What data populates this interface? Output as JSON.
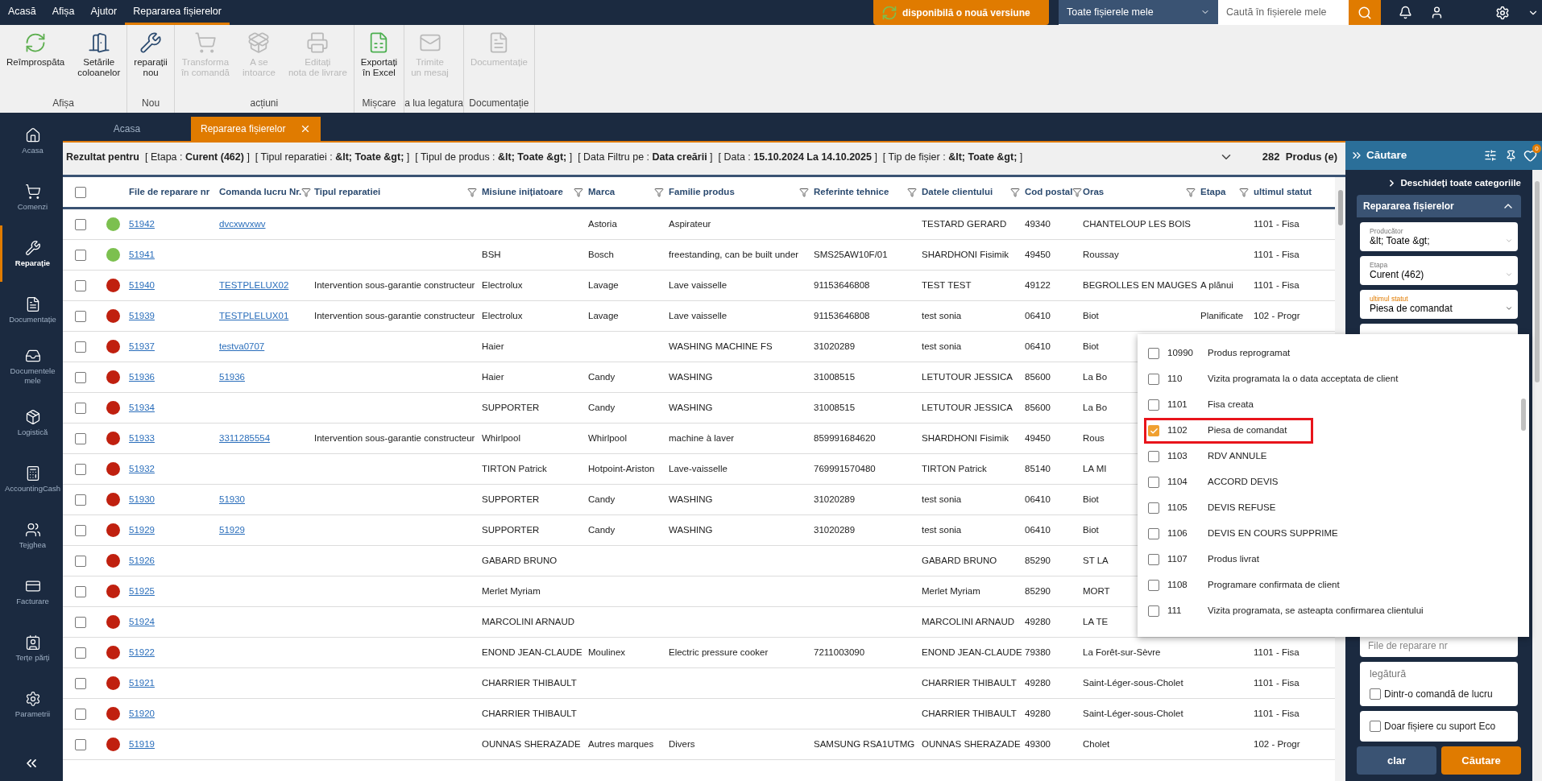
{
  "menu": [
    {
      "label": "Acasă",
      "selected": false
    },
    {
      "label": "Afișa",
      "selected": false
    },
    {
      "label": "Ajutor",
      "selected": false
    },
    {
      "label": "Repararea fișierelor",
      "selected": true
    }
  ],
  "update_button": "disponibilă o nouă versiune",
  "scope_select": "Toate fișierele mele",
  "search": {
    "placeholder": "Caută în fișierele mele"
  },
  "ribbon": [
    {
      "group": "Afișa",
      "buttons": [
        {
          "label": "Reîmprospăta",
          "disabled": false
        },
        {
          "label": "Setările\ncoloanelor",
          "disabled": false
        }
      ]
    },
    {
      "group": "Nou",
      "buttons": [
        {
          "label": "reparații\nnou",
          "disabled": false
        }
      ]
    },
    {
      "group": "acțiuni",
      "buttons": [
        {
          "label": "Transforma\nîn comandă",
          "disabled": true
        },
        {
          "label": "A se\nintoarce",
          "disabled": true
        },
        {
          "label": "Editați\nnota de livrare",
          "disabled": true
        }
      ]
    },
    {
      "group": "Mișcare",
      "buttons": [
        {
          "label": "Exportați\nîn Excel",
          "disabled": false
        }
      ]
    },
    {
      "group": "a lua legatura",
      "buttons": [
        {
          "label": "Trimite\nun mesaj",
          "disabled": true
        }
      ]
    },
    {
      "group": "Documentație",
      "buttons": [
        {
          "label": "Documentație",
          "disabled": true
        }
      ]
    }
  ],
  "sidebar": [
    {
      "label": "Acasa",
      "selected": false
    },
    {
      "label": "Comenzi",
      "selected": false
    },
    {
      "label": "Reparație",
      "selected": true
    },
    {
      "label": "Documentație",
      "selected": false
    },
    {
      "label": "Documentele mele",
      "selected": false
    },
    {
      "label": "Logistică",
      "selected": false
    },
    {
      "label": "AccountingCash",
      "selected": false
    },
    {
      "label": "Tejghea",
      "selected": false
    },
    {
      "label": "Facturare",
      "selected": false
    },
    {
      "label": "Terțe părți",
      "selected": false
    },
    {
      "label": "Parametrii",
      "selected": false
    }
  ],
  "tabs": [
    {
      "label": "Acasa",
      "selected": false
    },
    {
      "label": "Repararea fișierelor",
      "selected": true
    }
  ],
  "result_summary": "**Rezultat pentru**  [ Etapa : **Curent (462)** ]  [ Tipul reparatiei : **&lt; Toate &gt;** ]  [ Tipul de produs : **&lt; Toate &gt;** ]  [ Data Filtru pe : **Data creării** ]  [ Data : **15.10.2024 La 14.10.2025** ]  [ Tip de fișier : **&lt; Toate &gt;** ]",
  "result_count": "282  Produs (e)",
  "table": {
    "select_all_checked": false,
    "columns": [
      {
        "label": "File de reparare nr",
        "filter": false
      },
      {
        "label": "Comanda lucru Nr.",
        "filter": true
      },
      {
        "label": "Tipul reparatiei",
        "filter": true
      },
      {
        "label": "Misiune inițiatoare",
        "filter": true
      },
      {
        "label": "Marca",
        "filter": true
      },
      {
        "label": "Familie produs",
        "filter": true
      },
      {
        "label": "Referinte tehnice",
        "filter": true
      },
      {
        "label": "Datele clientului",
        "filter": true
      },
      {
        "label": "Cod postal",
        "filter": true
      },
      {
        "label": "Oras",
        "filter": true
      },
      {
        "label": "Etapa",
        "filter": true
      },
      {
        "label": "ultimul statut",
        "filter": false
      }
    ],
    "rows": [
      {
        "checked": false,
        "color": "#7cc04f",
        "file": "51942",
        "order": "dvcxwvxwv",
        "brand": "Astoria",
        "family": "Aspirateur",
        "client": "TESTARD GERARD",
        "postcode": "49340",
        "city": "CHANTELOUP LES BOIS",
        "last_status": "1101 - Fisa"
      },
      {
        "checked": false,
        "color": "#7cc04f",
        "file": "51941",
        "mission": "BSH",
        "brand": "Bosch",
        "family": "freestanding, can be built under",
        "tech_ref": "SMS25AW10F/01",
        "client": "SHARDHONI Fisimik",
        "postcode": "49450",
        "city": "Roussay",
        "last_status": "1101 - Fisa"
      },
      {
        "checked": false,
        "color": "#c0200f",
        "file": "51940",
        "order": "TESTPLELUX02",
        "repair_type": "Intervention sous-garantie constructeur",
        "mission": "Electrolux",
        "brand": "Lavage",
        "family": "Lave vaisselle",
        "tech_ref": "91153646808",
        "client": "TEST TEST",
        "postcode": "49122",
        "city": "BEGROLLES EN MAUGES",
        "stage": "A plănui",
        "last_status": "1101 - Fisa"
      },
      {
        "checked": false,
        "color": "#c0200f",
        "file": "51939",
        "order": "TESTPLELUX01",
        "repair_type": "Intervention sous-garantie constructeur",
        "mission": "Electrolux",
        "brand": "Lavage",
        "family": "Lave vaisselle",
        "tech_ref": "91153646808",
        "client": "test  sonia",
        "postcode": "06410",
        "city": "Biot",
        "stage": "Planificate",
        "last_status": "102 - Progr"
      },
      {
        "checked": false,
        "color": "#c0200f",
        "file": "51937",
        "order": "testva0707",
        "mission": "Haier",
        "family": "WASHING MACHINE FS",
        "tech_ref": "31020289",
        "client": "test  sonia",
        "postcode": "06410",
        "city": "Biot"
      },
      {
        "checked": false,
        "color": "#c0200f",
        "file": "51936",
        "order": "51936",
        "mission": "Haier",
        "brand": "Candy",
        "family": "WASHING",
        "tech_ref": "31008515",
        "client": "LETUTOUR JESSICA",
        "postcode": "85600",
        "city": "La Bo"
      },
      {
        "checked": false,
        "color": "#c0200f",
        "file": "51934",
        "mission": "SUPPORTER",
        "brand": "Candy",
        "family": "WASHING",
        "tech_ref": "31008515",
        "client": "LETUTOUR JESSICA",
        "postcode": "85600",
        "city": "La Bo"
      },
      {
        "checked": false,
        "color": "#c0200f",
        "file": "51933",
        "order": "3311285554",
        "repair_type": "Intervention sous-garantie constructeur",
        "mission": "Whirlpool",
        "brand": "Whirlpool",
        "family": "machine à laver",
        "tech_ref": "859991684620",
        "client": "SHARDHONI Fisimik",
        "postcode": "49450",
        "city": "Rous"
      },
      {
        "checked": false,
        "color": "#c0200f",
        "file": "51932",
        "mission": "TIRTON Patrick",
        "brand": "Hotpoint-Ariston",
        "family": "Lave-vaisselle",
        "tech_ref": "769991570480",
        "client": "TIRTON Patrick",
        "postcode": "85140",
        "city": "LA MI"
      },
      {
        "checked": false,
        "color": "#c0200f",
        "file": "51930",
        "order": "51930",
        "mission": "SUPPORTER",
        "brand": "Candy",
        "family": "WASHING",
        "tech_ref": "31020289",
        "client": "test  sonia",
        "postcode": "06410",
        "city": "Biot"
      },
      {
        "checked": false,
        "color": "#c0200f",
        "file": "51929",
        "order": "51929",
        "mission": "SUPPORTER",
        "brand": "Candy",
        "family": "WASHING",
        "tech_ref": "31020289",
        "client": "test  sonia",
        "postcode": "06410",
        "city": "Biot"
      },
      {
        "checked": false,
        "color": "#c0200f",
        "file": "51926",
        "mission": "GABARD BRUNO",
        "client": "GABARD BRUNO",
        "postcode": "85290",
        "city": "ST LA"
      },
      {
        "checked": false,
        "color": "#c0200f",
        "file": "51925",
        "mission": "Merlet Myriam",
        "client": "Merlet Myriam",
        "postcode": "85290",
        "city": "MORT"
      },
      {
        "checked": false,
        "color": "#c0200f",
        "file": "51924",
        "mission": "MARCOLINI ARNAUD",
        "client": "MARCOLINI ARNAUD",
        "postcode": "49280",
        "city": "LA TE"
      },
      {
        "checked": false,
        "color": "#c0200f",
        "file": "51922",
        "mission": "ENOND JEAN-CLAUDE",
        "brand": "Moulinex",
        "family": "Electric pressure cooker",
        "tech_ref": "7211003090",
        "client": "ENOND JEAN-CLAUDE",
        "postcode": "79380",
        "city": "La Forêt-sur-Sèvre",
        "last_status": "1101 - Fisa"
      },
      {
        "checked": false,
        "color": "#c0200f",
        "file": "51921",
        "mission": "CHARRIER THIBAULT",
        "client": "CHARRIER THIBAULT",
        "postcode": "49280",
        "city": "Saint-Léger-sous-Cholet",
        "last_status": "1101 - Fisa"
      },
      {
        "checked": false,
        "color": "#c0200f",
        "file": "51920",
        "mission": "CHARRIER THIBAULT",
        "client": "CHARRIER THIBAULT",
        "postcode": "49280",
        "city": "Saint-Léger-sous-Cholet",
        "last_status": "1101 - Fisa"
      },
      {
        "checked": false,
        "color": "#c0200f",
        "file": "51919",
        "mission": "OUNNAS SHERAZADE",
        "brand": "Autres marques",
        "family": "Divers",
        "tech_ref": "SAMSUNG RSA1UTMG",
        "client": "OUNNAS SHERAZADE",
        "postcode": "49300",
        "city": "Cholet",
        "last_status": "102 - Progr"
      }
    ]
  },
  "search_panel": {
    "title": "Căutare",
    "badge": "0",
    "expand_all": "Deschideți toate categoriile",
    "section": {
      "title": "Repararea fișierelor",
      "expanded": true
    },
    "fields": [
      {
        "label": "Producător",
        "value": "&lt; Toate &gt;",
        "active": false
      },
      {
        "label": "Etapa",
        "value": "Curent (462)",
        "active": false
      },
      {
        "label": "ultimul statut",
        "value": "Piesa de comandat",
        "active": true
      }
    ],
    "file_number": {
      "placeholder": "File de reparare nr"
    },
    "link_group": {
      "title": "legătură",
      "option": {
        "label": "Dintr-o comandă de lucru",
        "checked": false
      }
    },
    "eco": {
      "label": "Doar fișiere cu suport Eco",
      "checked": false
    },
    "clear_button": "clar",
    "search_button": "Căutare"
  },
  "status_dropdown": [
    {
      "code": "10990",
      "label": "Produs reprogramat",
      "checked": false,
      "highlighted": false
    },
    {
      "code": "110",
      "label": "Vizita programata la o data acceptata de client",
      "checked": false,
      "highlighted": false
    },
    {
      "code": "1101",
      "label": "Fisa creata",
      "checked": false,
      "highlighted": false
    },
    {
      "code": "1102",
      "label": "Piesa de comandat",
      "checked": true,
      "highlighted": true
    },
    {
      "code": "1103",
      "label": "RDV ANNULE",
      "checked": false,
      "highlighted": false
    },
    {
      "code": "1104",
      "label": "ACCORD DEVIS",
      "checked": false,
      "highlighted": false
    },
    {
      "code": "1105",
      "label": "DEVIS REFUSE",
      "checked": false,
      "highlighted": false
    },
    {
      "code": "1106",
      "label": "DEVIS EN COURS SUPPRIME",
      "checked": false,
      "highlighted": false
    },
    {
      "code": "1107",
      "label": "Produs livrat",
      "checked": false,
      "highlighted": false
    },
    {
      "code": "1108",
      "label": "Programare confirmata de client",
      "checked": false,
      "highlighted": false
    },
    {
      "code": "111",
      "label": "Vizita programata, se asteapta confirmarea clientului",
      "checked": false,
      "highlighted": false
    }
  ]
}
